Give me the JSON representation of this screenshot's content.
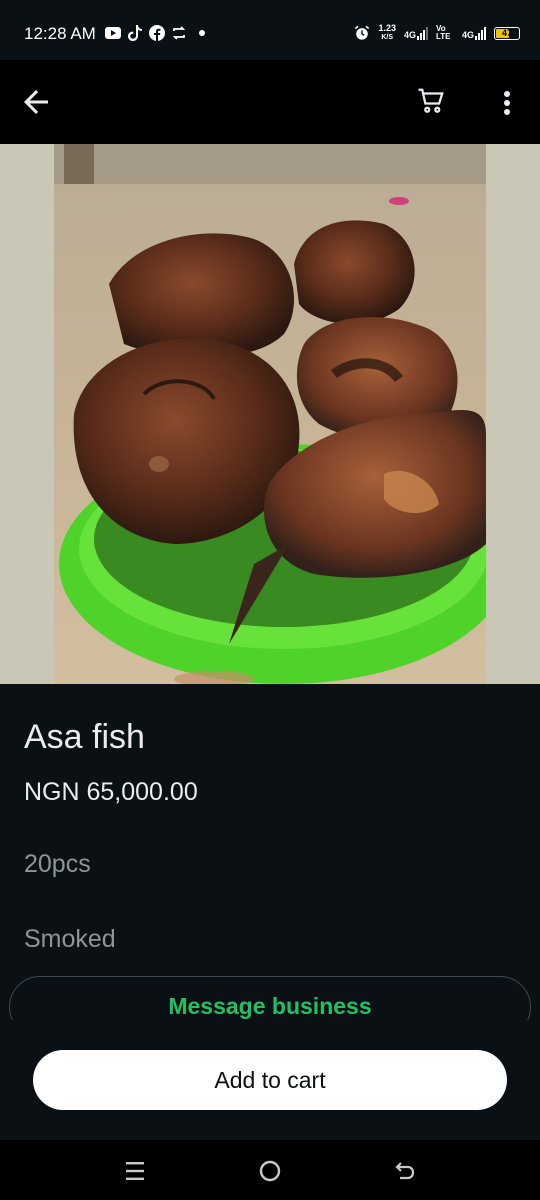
{
  "status_bar": {
    "time": "12:28 AM",
    "icons": [
      "youtube-icon",
      "tiktok-icon",
      "facebook-icon",
      "sync-icon"
    ],
    "speed_value": "1.23",
    "speed_unit": "K/S",
    "net1": "4G",
    "volte": "Vo LTE",
    "net2": "4G",
    "battery": "47"
  },
  "app_bar": {
    "back_icon": "arrow-back-icon",
    "cart_icon": "cart-icon",
    "more_icon": "more-vert-icon"
  },
  "product": {
    "image": "smoked-fish-in-green-bowl",
    "title": "Asa fish",
    "price": "NGN 65,000.00",
    "quantity": "20pcs",
    "description": "Smoked"
  },
  "actions": {
    "message_label": "Message business",
    "add_to_cart_label": "Add to cart"
  },
  "colors": {
    "accent_green": "#21c063",
    "background": "#0b1014",
    "button_white": "#ffffff"
  },
  "nav_bar": {
    "icons": [
      "recents-icon",
      "home-icon",
      "back-nav-icon"
    ]
  }
}
